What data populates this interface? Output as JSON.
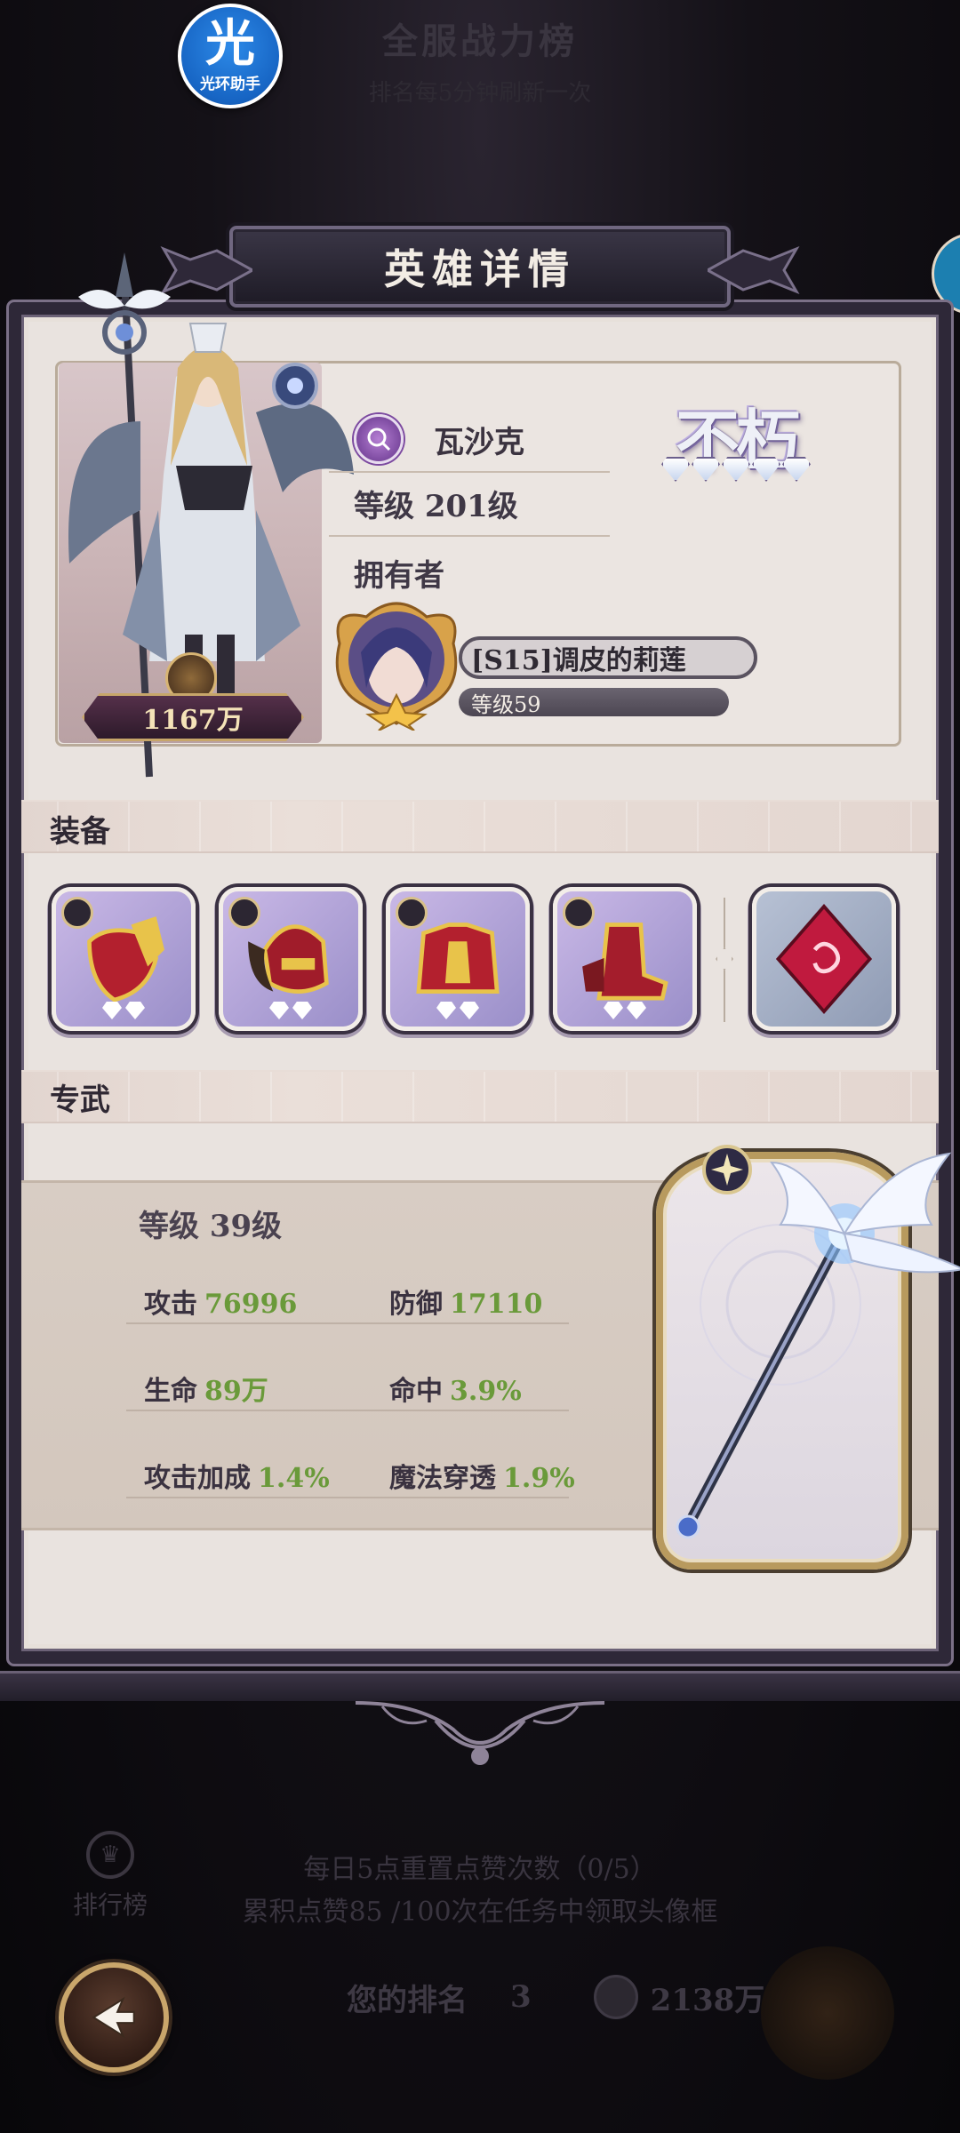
{
  "background": {
    "title": "全服战力榜",
    "subtitle": "排名每5分钟刷新一次",
    "leaderboard_label": "排行榜",
    "note_line1": "每日5点重置点赞次数（0/5）",
    "note_line2": "累积点赞85 /100次在任务中领取头像框",
    "your_rank_label": "您的排名",
    "your_rank_value": "3",
    "your_power": "2138万"
  },
  "app_badge": {
    "glyph": "光",
    "label": "光环助手"
  },
  "modal": {
    "title": "英雄详情",
    "hero": {
      "name": "瓦沙克",
      "level": "等级 201级",
      "power": "1167万",
      "rarity": "不朽",
      "rarity_stars": 5,
      "faction_icon": "faction-orb-icon"
    },
    "owner": {
      "label": "拥有者",
      "name": "[S15]调皮的莉莲",
      "level": "等级59"
    },
    "equipment": {
      "title": "装备",
      "items": [
        {
          "name": "gauntlet-armor-icon",
          "stars": 2
        },
        {
          "name": "helmet-armor-icon",
          "stars": 2
        },
        {
          "name": "chest-armor-icon",
          "stars": 2
        },
        {
          "name": "boots-armor-icon",
          "stars": 2
        }
      ],
      "rune": "crimson-rune-crystal-icon"
    },
    "exclusive": {
      "title": "专武",
      "level": "等级 39级",
      "stats": [
        {
          "label": "攻击",
          "value": "76996"
        },
        {
          "label": "防御",
          "value": "17110"
        },
        {
          "label": "生命",
          "value": "89万"
        },
        {
          "label": "命中",
          "value": "3.9%"
        },
        {
          "label": "攻击加成",
          "value": "1.4%"
        },
        {
          "label": "魔法穿透",
          "value": "1.9%"
        }
      ],
      "weapon": "winged-staff-icon"
    }
  },
  "colors": {
    "frame": "#2e2838",
    "panel": "#e9e3df",
    "stat_value": "#6a9a3a",
    "gold_trim": "#c9a66b"
  }
}
